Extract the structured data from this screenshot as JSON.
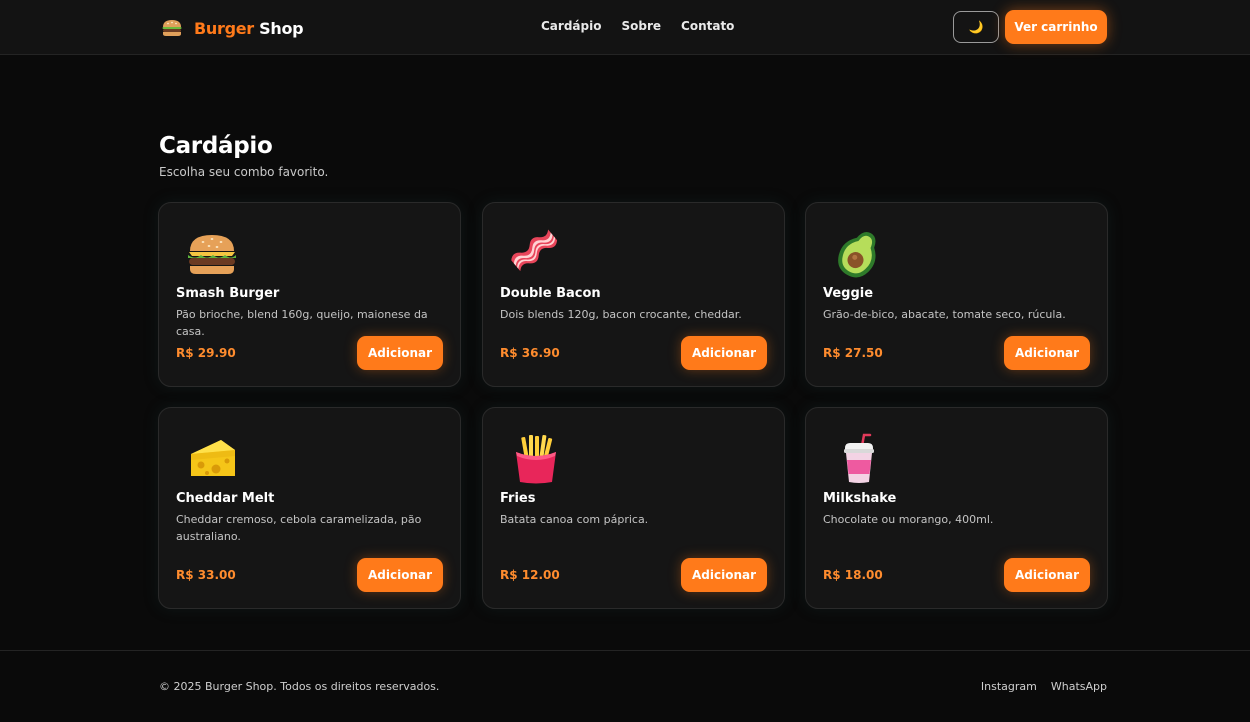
{
  "brand": {
    "accent": "Burger",
    "rest": " Shop",
    "accent_color": "#ff7a1a"
  },
  "nav": {
    "items": [
      "Cardápio",
      "Sobre",
      "Contato"
    ]
  },
  "header": {
    "theme_icon": "moon-icon",
    "theme_glyph": "🌙",
    "cart_label": "Ver carrinho"
  },
  "menu": {
    "title": "Cardápio",
    "subtitle": "Escolha seu combo favorito.",
    "items": [
      {
        "name": "Smash Burger",
        "desc": "Pão brioche, blend 160g, queijo, maionese da casa.",
        "price": "R$ 29.90",
        "button": "Adicionar",
        "icon": "burger-icon"
      },
      {
        "name": "Double Bacon",
        "desc": "Dois blends 120g, bacon crocante, cheddar.",
        "price": "R$ 36.90",
        "button": "Adicionar",
        "icon": "bacon-icon"
      },
      {
        "name": "Veggie",
        "desc": "Grão-de-bico, abacate, tomate seco, rúcula.",
        "price": "R$ 27.50",
        "button": "Adicionar",
        "icon": "avocado-icon"
      },
      {
        "name": "Cheddar Melt",
        "desc": "Cheddar cremoso, cebola caramelizada, pão australiano.",
        "price": "R$ 33.00",
        "button": "Adicionar",
        "icon": "cheese-icon"
      },
      {
        "name": "Fries",
        "desc": "Batata canoa com páprica.",
        "price": "R$ 12.00",
        "button": "Adicionar",
        "icon": "fries-icon"
      },
      {
        "name": "Milkshake",
        "desc": "Chocolate ou morango, 400ml.",
        "price": "R$ 18.00",
        "button": "Adicionar",
        "icon": "milkshake-icon"
      }
    ]
  },
  "footer": {
    "copyright": "© 2025 Burger Shop. Todos os direitos reservados.",
    "links": [
      "Instagram",
      "WhatsApp"
    ]
  }
}
